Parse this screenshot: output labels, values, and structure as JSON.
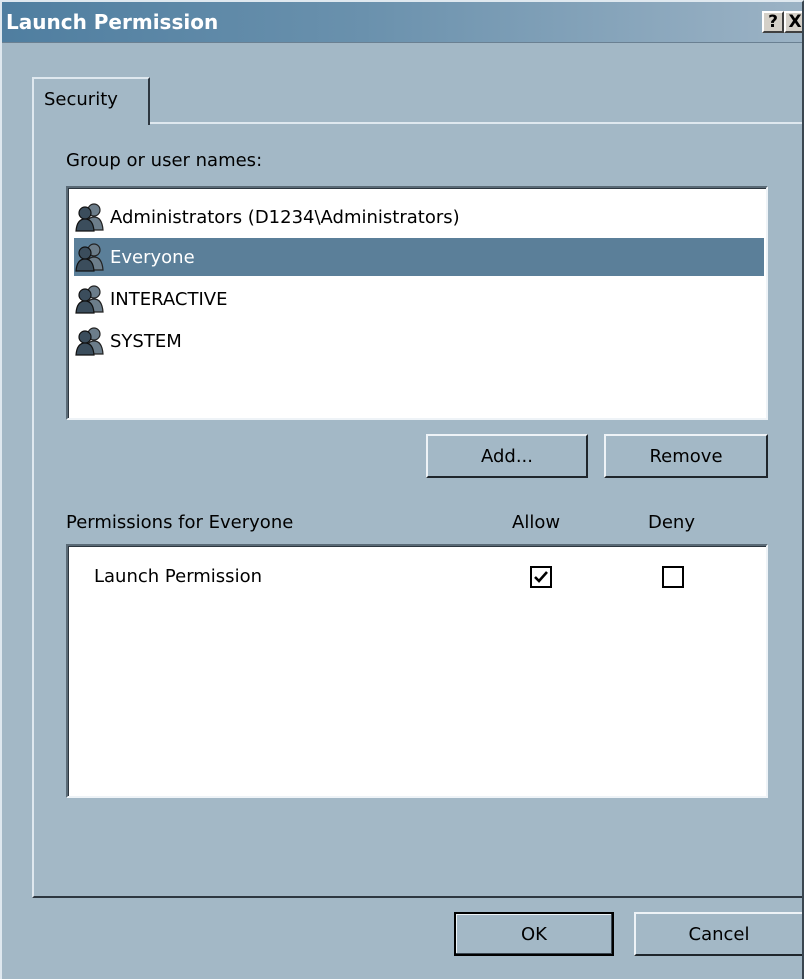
{
  "window": {
    "title": "Launch Permission",
    "help_button": "?",
    "close_button": "X"
  },
  "tabs": [
    {
      "label": "Security",
      "active": true
    }
  ],
  "group_section": {
    "label": "Group or user names:",
    "items": [
      {
        "label": "Administrators (D1234\\Administrators)",
        "icon": "group-users-icon",
        "selected": false
      },
      {
        "label": "Everyone",
        "icon": "group-users-icon",
        "selected": true
      },
      {
        "label": "INTERACTIVE",
        "icon": "group-users-icon",
        "selected": false
      },
      {
        "label": "SYSTEM",
        "icon": "group-users-icon",
        "selected": false
      }
    ],
    "add_label": "Add...",
    "remove_label": "Remove"
  },
  "permissions_section": {
    "label": "Permissions for Everyone",
    "allow_header": "Allow",
    "deny_header": "Deny",
    "rows": [
      {
        "label": "Launch Permission",
        "allow": true,
        "deny": false
      }
    ]
  },
  "footer": {
    "ok_label": "OK",
    "cancel_label": "Cancel"
  },
  "colors": {
    "dialog_bg": "#a3b8c6",
    "selection_bg": "#5b7f99",
    "titlebar_start": "#4f7ea0"
  }
}
